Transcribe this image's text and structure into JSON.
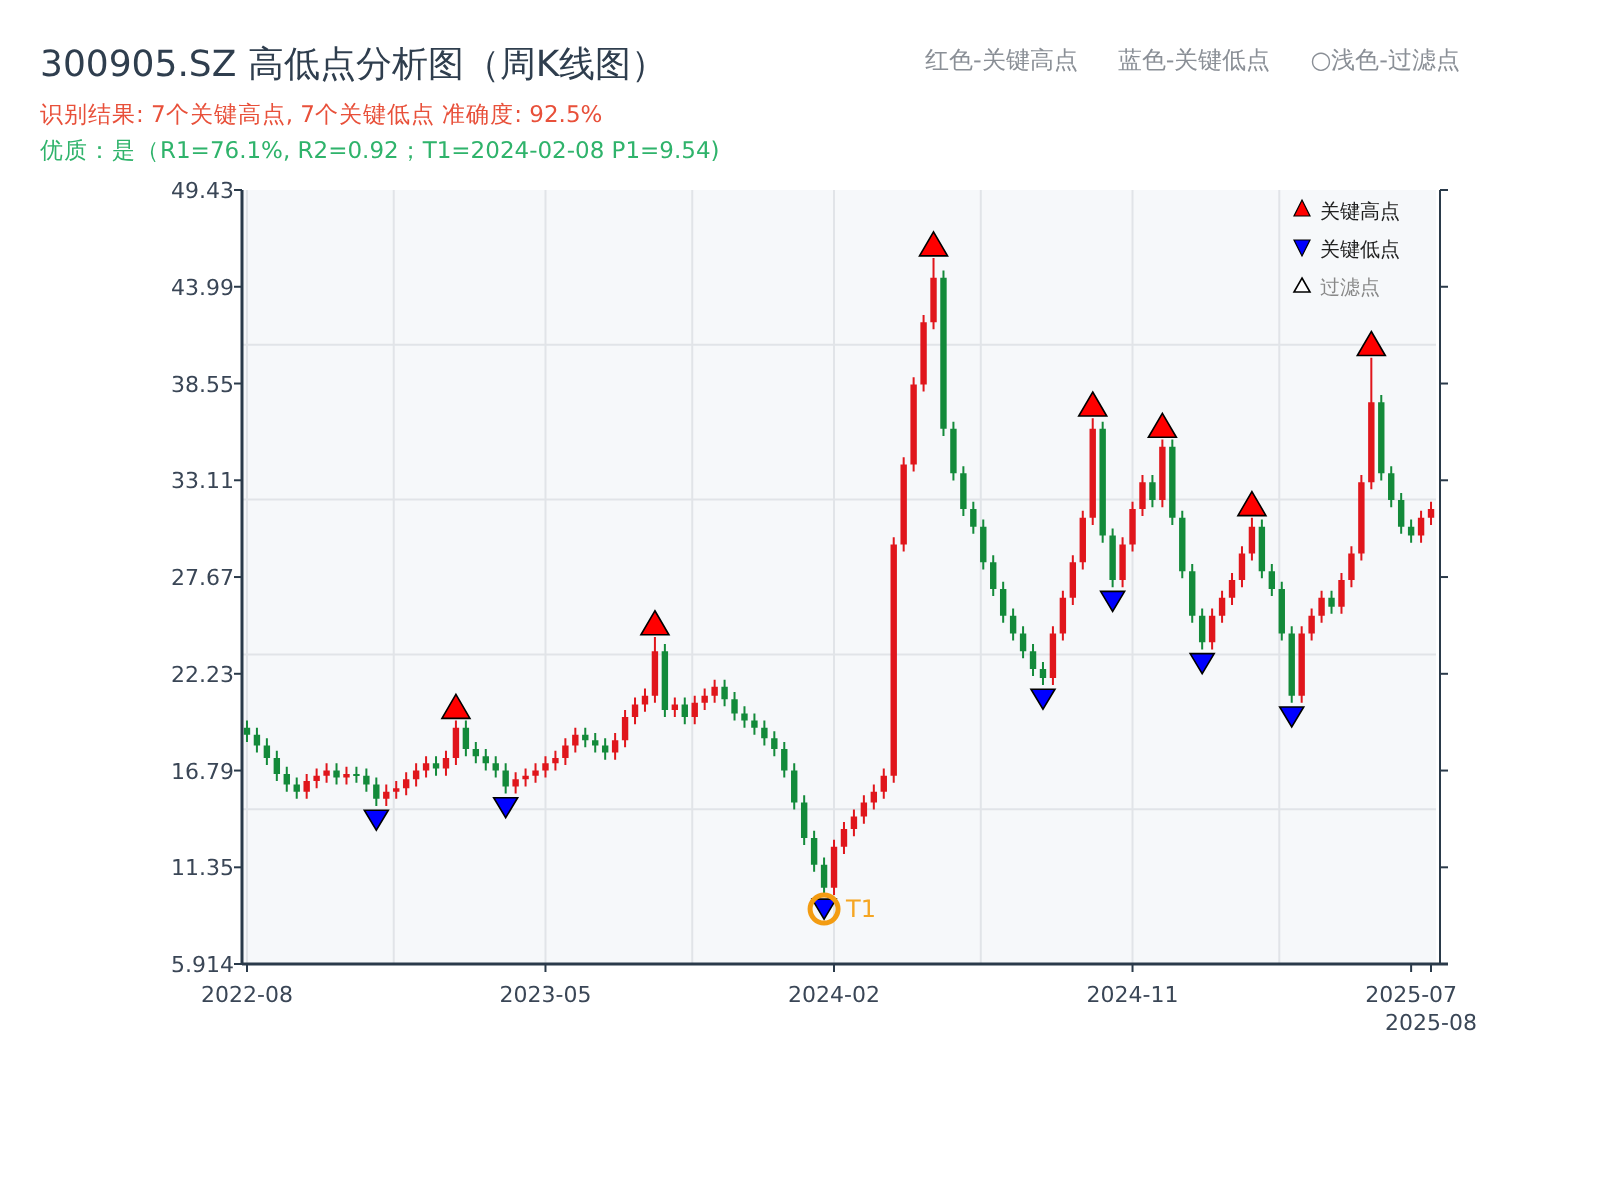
{
  "title": "300905.SZ 高低点分析图（周K线图）",
  "hints": [
    "红色-关键高点",
    "蓝色-关键低点",
    "○浅色-过滤点"
  ],
  "result_line": "识别结果: 7个关键高点, 7个关键低点  准确度: 92.5%",
  "quality_line": "优质：是（R1=76.1%, R2=0.92；T1=2024-02-08 P1=9.54)",
  "legend": {
    "filtered": "过滤点"
  },
  "chart": {
    "chart_data": {
      "type": "candlestick",
      "grid": true,
      "legend": "upper right",
      "ylim": [
        5.914,
        49.43
      ],
      "yticks": [
        5.914,
        11.35,
        16.79,
        22.23,
        27.67,
        33.11,
        38.55,
        43.99,
        49.43
      ],
      "categories": [
        "2022-08",
        null,
        null,
        null,
        null,
        null,
        null,
        null,
        null,
        null,
        null,
        null,
        null,
        null,
        null,
        null,
        null,
        null,
        null,
        null,
        null,
        null,
        null,
        null,
        null,
        null,
        null,
        null,
        null,
        null,
        "2023-05",
        null,
        null,
        null,
        null,
        null,
        null,
        null,
        null,
        null,
        null,
        null,
        null,
        null,
        null,
        null,
        null,
        null,
        null,
        null,
        null,
        null,
        null,
        null,
        null,
        null,
        null,
        null,
        null,
        "2024-02",
        null,
        null,
        null,
        null,
        null,
        null,
        null,
        null,
        null,
        null,
        null,
        null,
        null,
        null,
        null,
        null,
        null,
        null,
        null,
        null,
        null,
        null,
        null,
        null,
        null,
        null,
        null,
        null,
        null,
        "2024-11",
        null,
        null,
        null,
        null,
        null,
        null,
        null,
        null,
        null,
        null,
        null,
        null,
        null,
        null,
        null,
        null,
        null,
        null,
        null,
        null,
        null,
        null,
        null,
        null,
        null,
        null,
        null,
        "2025-07",
        null,
        "2025-08"
      ],
      "ohlc": [
        [
          19.2,
          19.6,
          18.4,
          18.8
        ],
        [
          18.8,
          19.2,
          17.8,
          18.2
        ],
        [
          18.2,
          18.6,
          17.1,
          17.5
        ],
        [
          17.5,
          17.9,
          16.2,
          16.6
        ],
        [
          16.6,
          17.0,
          15.6,
          16.0
        ],
        [
          16.0,
          16.4,
          15.2,
          15.6
        ],
        [
          15.6,
          16.6,
          15.2,
          16.2
        ],
        [
          16.2,
          16.9,
          15.8,
          16.5
        ],
        [
          16.5,
          17.2,
          16.1,
          16.8
        ],
        [
          16.8,
          17.2,
          16.0,
          16.4
        ],
        [
          16.4,
          17.0,
          16.0,
          16.6
        ],
        [
          16.6,
          17.0,
          16.1,
          16.5
        ],
        [
          16.5,
          16.9,
          15.6,
          16.0
        ],
        [
          16.0,
          16.4,
          14.8,
          15.2
        ],
        [
          15.2,
          16.0,
          14.8,
          15.6
        ],
        [
          15.6,
          16.2,
          15.2,
          15.8
        ],
        [
          15.8,
          16.7,
          15.4,
          16.3
        ],
        [
          16.3,
          17.2,
          15.9,
          16.8
        ],
        [
          16.8,
          17.6,
          16.4,
          17.2
        ],
        [
          17.2,
          17.6,
          16.5,
          16.9
        ],
        [
          16.9,
          17.9,
          16.5,
          17.5
        ],
        [
          17.5,
          19.6,
          17.1,
          19.2
        ],
        [
          19.2,
          19.6,
          17.6,
          18.0
        ],
        [
          18.0,
          18.4,
          17.2,
          17.6
        ],
        [
          17.6,
          18.0,
          16.8,
          17.2
        ],
        [
          17.2,
          17.6,
          16.4,
          16.8
        ],
        [
          16.8,
          17.2,
          15.5,
          15.9
        ],
        [
          15.9,
          16.7,
          15.5,
          16.3
        ],
        [
          16.3,
          16.9,
          15.9,
          16.5
        ],
        [
          16.5,
          17.2,
          16.1,
          16.8
        ],
        [
          16.8,
          17.6,
          16.4,
          17.2
        ],
        [
          17.2,
          17.9,
          16.8,
          17.5
        ],
        [
          17.5,
          18.6,
          17.1,
          18.2
        ],
        [
          18.2,
          19.2,
          17.8,
          18.8
        ],
        [
          18.8,
          19.2,
          18.1,
          18.5
        ],
        [
          18.5,
          18.9,
          17.8,
          18.2
        ],
        [
          18.2,
          18.6,
          17.4,
          17.8
        ],
        [
          17.8,
          18.9,
          17.4,
          18.5
        ],
        [
          18.5,
          20.2,
          18.1,
          19.8
        ],
        [
          19.8,
          20.9,
          19.4,
          20.5
        ],
        [
          20.5,
          21.4,
          20.1,
          21.0
        ],
        [
          21.0,
          24.3,
          20.6,
          23.5
        ],
        [
          23.5,
          23.9,
          19.8,
          20.2
        ],
        [
          20.2,
          20.9,
          19.8,
          20.5
        ],
        [
          20.5,
          20.9,
          19.4,
          19.8
        ],
        [
          19.8,
          21.0,
          19.4,
          20.6
        ],
        [
          20.6,
          21.4,
          20.2,
          21.0
        ],
        [
          21.0,
          21.9,
          20.6,
          21.5
        ],
        [
          21.5,
          21.9,
          20.4,
          20.8
        ],
        [
          20.8,
          21.2,
          19.6,
          20.0
        ],
        [
          20.0,
          20.4,
          19.2,
          19.6
        ],
        [
          19.6,
          20.0,
          18.8,
          19.2
        ],
        [
          19.2,
          19.6,
          18.2,
          18.6
        ],
        [
          18.6,
          19.0,
          17.6,
          18.0
        ],
        [
          18.0,
          18.4,
          16.4,
          16.8
        ],
        [
          16.8,
          17.2,
          14.6,
          15.0
        ],
        [
          15.0,
          15.4,
          12.6,
          13.0
        ],
        [
          13.0,
          13.4,
          11.1,
          11.5
        ],
        [
          11.5,
          11.9,
          9.8,
          10.2
        ],
        [
          10.2,
          12.9,
          9.8,
          12.5
        ],
        [
          12.5,
          13.9,
          12.1,
          13.5
        ],
        [
          13.5,
          14.6,
          13.1,
          14.2
        ],
        [
          14.2,
          15.4,
          13.8,
          15.0
        ],
        [
          15.0,
          16.0,
          14.6,
          15.6
        ],
        [
          15.6,
          16.9,
          15.2,
          16.5
        ],
        [
          16.5,
          29.9,
          16.1,
          29.5
        ],
        [
          29.5,
          34.4,
          29.1,
          34.0
        ],
        [
          34.0,
          38.9,
          33.6,
          38.5
        ],
        [
          38.5,
          42.4,
          38.1,
          42.0
        ],
        [
          42.0,
          45.6,
          41.6,
          44.5
        ],
        [
          44.5,
          44.9,
          35.6,
          36.0
        ],
        [
          36.0,
          36.4,
          33.1,
          33.5
        ],
        [
          33.5,
          33.9,
          31.1,
          31.5
        ],
        [
          31.5,
          31.9,
          30.1,
          30.5
        ],
        [
          30.5,
          30.9,
          28.1,
          28.5
        ],
        [
          28.5,
          28.9,
          26.6,
          27.0
        ],
        [
          27.0,
          27.4,
          25.1,
          25.5
        ],
        [
          25.5,
          25.9,
          24.1,
          24.5
        ],
        [
          24.5,
          24.9,
          23.1,
          23.5
        ],
        [
          23.5,
          23.9,
          22.1,
          22.5
        ],
        [
          22.5,
          22.9,
          21.6,
          22.0
        ],
        [
          22.0,
          24.9,
          21.6,
          24.5
        ],
        [
          24.5,
          26.9,
          24.1,
          26.5
        ],
        [
          26.5,
          28.9,
          26.1,
          28.5
        ],
        [
          28.5,
          31.4,
          28.1,
          31.0
        ],
        [
          31.0,
          36.6,
          30.6,
          36.0
        ],
        [
          36.0,
          36.4,
          29.6,
          30.0
        ],
        [
          30.0,
          30.4,
          27.1,
          27.5
        ],
        [
          27.5,
          29.9,
          27.1,
          29.5
        ],
        [
          29.5,
          31.9,
          29.1,
          31.5
        ],
        [
          31.5,
          33.4,
          31.1,
          33.0
        ],
        [
          33.0,
          33.4,
          31.6,
          32.0
        ],
        [
          32.0,
          35.4,
          31.6,
          35.0
        ],
        [
          35.0,
          35.4,
          30.6,
          31.0
        ],
        [
          31.0,
          31.4,
          27.6,
          28.0
        ],
        [
          28.0,
          28.4,
          25.1,
          25.5
        ],
        [
          25.5,
          25.9,
          23.6,
          24.0
        ],
        [
          24.0,
          25.9,
          23.6,
          25.5
        ],
        [
          25.5,
          26.9,
          25.1,
          26.5
        ],
        [
          26.5,
          27.9,
          26.1,
          27.5
        ],
        [
          27.5,
          29.4,
          27.1,
          29.0
        ],
        [
          29.0,
          31.0,
          28.6,
          30.5
        ],
        [
          30.5,
          30.9,
          27.6,
          28.0
        ],
        [
          28.0,
          28.4,
          26.6,
          27.0
        ],
        [
          27.0,
          27.4,
          24.1,
          24.5
        ],
        [
          24.5,
          24.9,
          20.6,
          21.0
        ],
        [
          21.0,
          24.9,
          20.6,
          24.5
        ],
        [
          24.5,
          25.9,
          24.1,
          25.5
        ],
        [
          25.5,
          26.9,
          25.1,
          26.5
        ],
        [
          26.5,
          26.9,
          25.6,
          26.0
        ],
        [
          26.0,
          27.9,
          25.6,
          27.5
        ],
        [
          27.5,
          29.4,
          27.1,
          29.0
        ],
        [
          29.0,
          33.4,
          28.6,
          33.0
        ],
        [
          33.0,
          40.0,
          32.6,
          37.5
        ],
        [
          37.5,
          37.9,
          33.1,
          33.5
        ],
        [
          33.5,
          33.9,
          31.6,
          32.0
        ],
        [
          32.0,
          32.4,
          30.1,
          30.5
        ],
        [
          30.5,
          30.9,
          29.6,
          30.0
        ],
        [
          30.0,
          31.4,
          29.6,
          31.0
        ],
        [
          31.0,
          31.9,
          30.6,
          31.5
        ]
      ],
      "series": [
        {
          "name": "关键高点",
          "type": "scatter",
          "color": "#ff0000",
          "values": [
            null,
            null,
            null,
            null,
            null,
            null,
            null,
            null,
            null,
            null,
            null,
            null,
            null,
            null,
            null,
            null,
            null,
            null,
            null,
            null,
            null,
            20.4,
            null,
            null,
            null,
            null,
            null,
            null,
            null,
            null,
            null,
            null,
            null,
            null,
            null,
            null,
            null,
            null,
            null,
            null,
            null,
            25.1,
            null,
            null,
            null,
            null,
            null,
            null,
            null,
            null,
            null,
            null,
            null,
            null,
            null,
            null,
            null,
            null,
            null,
            null,
            null,
            null,
            null,
            null,
            null,
            null,
            null,
            null,
            null,
            46.4,
            null,
            null,
            null,
            null,
            null,
            null,
            null,
            null,
            null,
            null,
            null,
            null,
            null,
            null,
            null,
            37.4,
            null,
            null,
            null,
            null,
            null,
            null,
            36.2,
            null,
            null,
            null,
            null,
            null,
            null,
            null,
            null,
            31.8,
            null,
            null,
            null,
            null,
            null,
            null,
            null,
            null,
            null,
            null,
            null,
            40.8,
            null,
            null,
            null,
            null,
            null,
            null
          ]
        },
        {
          "name": "关键低点",
          "type": "scatter",
          "color": "#0000ff",
          "values": [
            null,
            null,
            null,
            null,
            null,
            null,
            null,
            null,
            null,
            null,
            null,
            null,
            null,
            14.0,
            null,
            null,
            null,
            null,
            null,
            null,
            null,
            null,
            null,
            null,
            null,
            null,
            14.7,
            null,
            null,
            null,
            null,
            null,
            null,
            null,
            null,
            null,
            null,
            null,
            null,
            null,
            null,
            null,
            null,
            null,
            null,
            null,
            null,
            null,
            null,
            null,
            null,
            null,
            null,
            null,
            null,
            null,
            null,
            null,
            9.0,
            null,
            null,
            null,
            null,
            null,
            null,
            null,
            null,
            null,
            null,
            null,
            null,
            null,
            null,
            null,
            null,
            null,
            null,
            null,
            null,
            null,
            20.8,
            null,
            null,
            null,
            null,
            null,
            null,
            26.3,
            null,
            null,
            null,
            null,
            null,
            null,
            null,
            null,
            22.8,
            null,
            null,
            null,
            null,
            null,
            null,
            null,
            null,
            19.8,
            null,
            null,
            null,
            null,
            null,
            null,
            null,
            null,
            null,
            null,
            null,
            null,
            null,
            null
          ]
        }
      ],
      "annotations": [
        "T1"
      ]
    }
  }
}
